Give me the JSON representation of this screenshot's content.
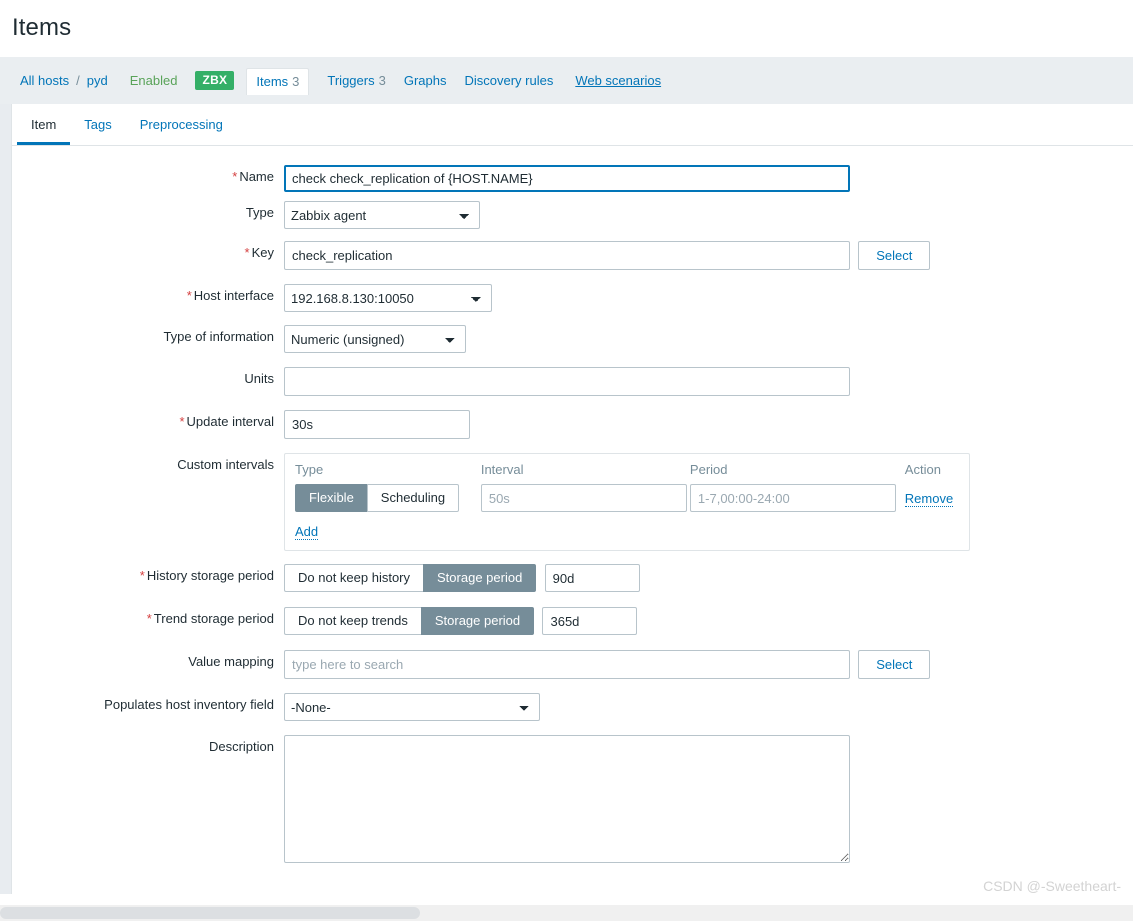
{
  "page": {
    "title": "Items",
    "watermark": "CSDN @-Sweetheart-"
  },
  "host_nav": {
    "all_hosts": "All hosts",
    "separator": "/",
    "host_name": "pyd",
    "status": "Enabled",
    "agent_badge": "ZBX",
    "tabs": [
      {
        "label": "Items",
        "count": "3",
        "selected": true
      },
      {
        "label": "Triggers",
        "count": "3",
        "selected": false
      },
      {
        "label": "Graphs",
        "count": "",
        "selected": false
      },
      {
        "label": "Discovery rules",
        "count": "",
        "selected": false
      },
      {
        "label": "Web scenarios",
        "count": "",
        "selected": false
      }
    ]
  },
  "form_tabs": [
    {
      "label": "Item",
      "active": true
    },
    {
      "label": "Tags",
      "active": false
    },
    {
      "label": "Preprocessing",
      "active": false
    }
  ],
  "form": {
    "name": {
      "label": "Name",
      "required": "*",
      "value": "check check_replication of {HOST.NAME}"
    },
    "type": {
      "label": "Type",
      "value": "Zabbix agent"
    },
    "key": {
      "label": "Key",
      "required": "*",
      "value": "check_replication",
      "select_button": "Select"
    },
    "host_interface": {
      "label": "Host interface",
      "required": "*",
      "value": "192.168.8.130:10050"
    },
    "type_of_information": {
      "label": "Type of information",
      "value": "Numeric (unsigned)"
    },
    "units": {
      "label": "Units",
      "value": ""
    },
    "update_interval": {
      "label": "Update interval",
      "required": "*",
      "value": "30s"
    },
    "custom_intervals": {
      "label": "Custom intervals",
      "columns": {
        "type": "Type",
        "interval": "Interval",
        "period": "Period",
        "action": "Action"
      },
      "row": {
        "type_flexible": "Flexible",
        "type_scheduling": "Scheduling",
        "type_selected": "Flexible",
        "interval_placeholder": "50s",
        "interval_value": "",
        "period_placeholder": "1-7,00:00-24:00",
        "period_value": "",
        "remove_link": "Remove"
      },
      "add_link": "Add"
    },
    "history_storage_period": {
      "label": "History storage period",
      "required": "*",
      "option_off": "Do not keep history",
      "option_on": "Storage period",
      "selected": "Storage period",
      "value": "90d"
    },
    "trend_storage_period": {
      "label": "Trend storage period",
      "required": "*",
      "option_off": "Do not keep trends",
      "option_on": "Storage period",
      "selected": "Storage period",
      "value": "365d"
    },
    "value_mapping": {
      "label": "Value mapping",
      "value": "",
      "placeholder": "type here to search",
      "select_button": "Select"
    },
    "host_inventory_field": {
      "label": "Populates host inventory field",
      "value": "-None-"
    },
    "description": {
      "label": "Description",
      "value": ""
    }
  },
  "colors": {
    "link": "#0275b8",
    "enabled_green": "#59a359",
    "badge_green": "#34af67",
    "required_red": "#d43f3f",
    "segment_selected": "#768d99",
    "nav_background": "#eaeef1",
    "border": "#b8c4cb"
  }
}
